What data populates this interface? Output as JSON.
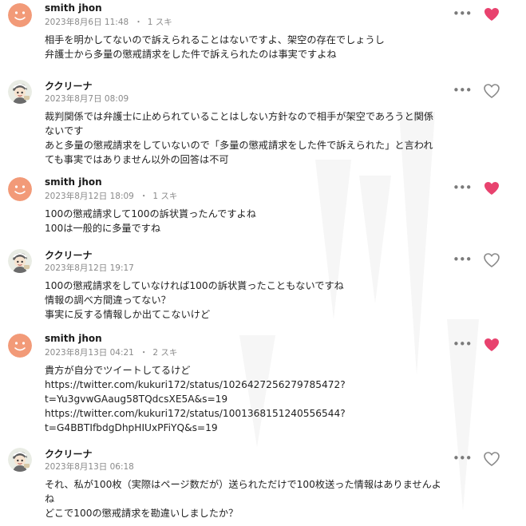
{
  "colors": {
    "liked": "#e8426e",
    "unliked": "#8a8a8a",
    "meta": "#8a8a8a",
    "text": "#222222"
  },
  "comments": [
    {
      "author": "smith jhon",
      "date": "2023年8月6日 11:48",
      "likes": "1 スキ",
      "liked": true,
      "avatar": "smiley-face-avatar",
      "lines": [
        "相手を明かしてないので訴えられることはないですよ、架空の存在でしょうし",
        "弁護士から多量の懲戒請求をした件で訴えられたのは事実ですよね"
      ]
    },
    {
      "author": "ククリーナ",
      "date": "2023年8月7日 08:09",
      "likes": "",
      "liked": false,
      "avatar": "character-avatar",
      "lines": [
        "裁判関係では弁護士に止められていることはしない方針なので相手が架空であろうと関係",
        "ないです",
        "あと多量の懲戒請求をしていないので「多量の懲戒請求をした件で訴えられた」と言われ",
        "ても事実ではありません以外の回答は不可"
      ]
    },
    {
      "author": "smith jhon",
      "date": "2023年8月12日 18:09",
      "likes": "1 スキ",
      "liked": true,
      "avatar": "smiley-face-avatar",
      "lines": [
        "100の懲戒請求して100の訴状貰ったんですよね",
        "100は一般的に多量ですね"
      ]
    },
    {
      "author": "ククリーナ",
      "date": "2023年8月12日 19:17",
      "likes": "",
      "liked": false,
      "avatar": "character-avatar",
      "lines": [
        "100の懲戒請求をしていなければ100の訴状貰ったこともないですね",
        "情報の調べ方間違ってない？",
        "事実に反する情報しか出てこないけど"
      ]
    },
    {
      "author": "smith jhon",
      "date": "2023年8月13日 04:21",
      "likes": "2 スキ",
      "liked": true,
      "avatar": "smiley-face-avatar",
      "lines": [
        "貴方が自分でツイートしてるけど",
        "https://twitter.com/kukuri172/status/1026427256279785472?",
        "t=Yu3gvwGAaug58TQdcsXE5A&s=19",
        "https://twitter.com/kukuri172/status/1001368151240556544?",
        "t=G4BBTIfbdgDhpHIUxPFiYQ&s=19"
      ]
    },
    {
      "author": "ククリーナ",
      "date": "2023年8月13日 06:18",
      "likes": "",
      "liked": false,
      "avatar": "character-avatar",
      "lines": [
        "それ、私が100枚（実際はページ数だが）送られただけで100枚送った情報はありませんよ",
        "ね",
        "どこで100の懲戒請求を勘違いしましたか？"
      ]
    }
  ]
}
